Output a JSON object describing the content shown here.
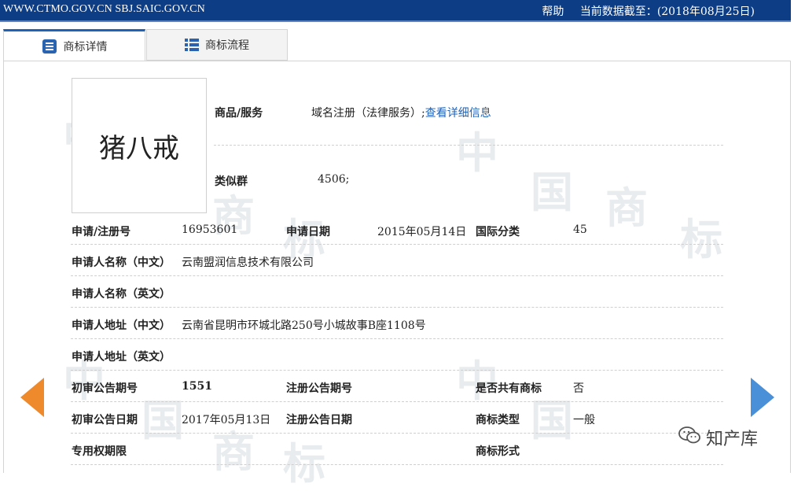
{
  "topbar": {
    "domains": "WWW.CTMO.GOV.CN SBJ.SAIC.GOV.CN",
    "help": "帮助",
    "data_as_of_label": "当前数据截至：",
    "data_as_of_value": "(2018年08月25日)"
  },
  "tabs": [
    {
      "label": "商标详情",
      "icon": "document-list-icon",
      "active": true
    },
    {
      "label": "商标流程",
      "icon": "list-icon",
      "active": false
    }
  ],
  "mark": {
    "text": "猪八戒"
  },
  "watermark": {
    "chars": [
      "中",
      "国",
      "商",
      "标"
    ]
  },
  "goods_services": {
    "label": "商品/服务",
    "value": "域名注册（法律服务）;",
    "link": "查看详细信息"
  },
  "similar_group": {
    "label": "类似群",
    "value": "4506;"
  },
  "fields": {
    "reg_no_label": "申请/注册号",
    "reg_no": "16953601",
    "app_date_label": "申请日期",
    "app_date": "2015年05月14日",
    "intl_class_label": "国际分类",
    "intl_class": "45",
    "applicant_cn_label": "申请人名称（中文）",
    "applicant_cn": "云南盟润信息技术有限公司",
    "applicant_en_label": "申请人名称（英文）",
    "applicant_en": "",
    "address_cn_label": "申请人地址（中文）",
    "address_cn": "云南省昆明市环城北路250号小城故事B座1108号",
    "address_en_label": "申请人地址（英文）",
    "address_en": "",
    "prelim_issue_label": "初审公告期号",
    "prelim_issue": "1551",
    "reg_issue_label": "注册公告期号",
    "reg_issue": "",
    "shared_label": "是否共有商标",
    "shared": "否",
    "prelim_date_label": "初审公告日期",
    "prelim_date": "2017年05月13日",
    "reg_date_label": "注册公告日期",
    "reg_date": "",
    "mark_type_label": "商标类型",
    "mark_type": "一般",
    "exclusive_period_label": "专用权期限",
    "exclusive_period": "",
    "mark_form_label": "商标形式",
    "mark_form": ""
  },
  "brand": {
    "text": "知产库",
    "icon": "wechat-icon"
  },
  "colors": {
    "topbar": "#0d3d85",
    "accent": "#1f62b6",
    "prev_arrow": "#ef8a2c",
    "next_arrow": "#4a90d8"
  }
}
